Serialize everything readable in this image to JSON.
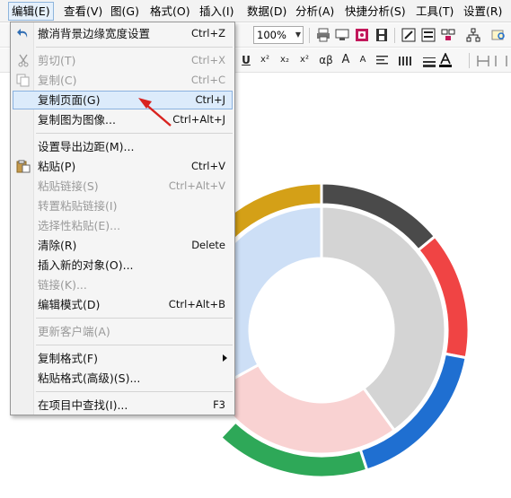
{
  "menubar": {
    "items": [
      {
        "label": "编辑(E)",
        "active": true
      },
      {
        "label": "查看(V)"
      },
      {
        "label": "图(G)"
      },
      {
        "label": "格式(O)"
      },
      {
        "label": "插入(I)"
      },
      {
        "label": "数据(D)"
      },
      {
        "label": "分析(A)"
      },
      {
        "label": "快捷分析(S)"
      },
      {
        "label": "工具(T)"
      },
      {
        "label": "设置(R)"
      }
    ]
  },
  "toolbar": {
    "zoom_value": "100%",
    "font_style_labels": [
      "U",
      "x²",
      "x₂",
      "x²",
      "αβ",
      "A",
      "A"
    ]
  },
  "edit_menu": {
    "items": [
      {
        "label": "撤消背景边缘宽度设置",
        "shortcut": "Ctrl+Z",
        "icon": "undo-icon"
      },
      {
        "label": "剪切(T)",
        "shortcut": "Ctrl+X",
        "disabled": true,
        "icon": "cut-icon"
      },
      {
        "label": "复制(C)",
        "shortcut": "Ctrl+C",
        "disabled": true,
        "icon": "copy-icon"
      },
      {
        "label": "复制页面(G)",
        "shortcut": "Ctrl+J",
        "highlighted": true
      },
      {
        "label": "复制图为图像...",
        "shortcut": "Ctrl+Alt+J"
      },
      {
        "label": "设置导出边距(M)...",
        "shortcut": ""
      },
      {
        "label": "粘贴(P)",
        "shortcut": "Ctrl+V",
        "icon": "paste-icon"
      },
      {
        "label": "粘贴链接(S)",
        "shortcut": "Ctrl+Alt+V",
        "disabled": true
      },
      {
        "label": "转置粘贴链接(I)",
        "shortcut": "",
        "disabled": true
      },
      {
        "label": "选择性粘贴(E)...",
        "shortcut": "",
        "disabled": true
      },
      {
        "label": "清除(R)",
        "shortcut": "Delete"
      },
      {
        "label": "插入新的对象(O)...",
        "shortcut": ""
      },
      {
        "label": "链接(K)...",
        "shortcut": "",
        "disabled": true
      },
      {
        "label": "编辑模式(D)",
        "shortcut": "Ctrl+Alt+B"
      },
      {
        "label": "更新客户端(A)",
        "shortcut": "",
        "disabled": true
      },
      {
        "label": "复制格式(F)",
        "shortcut": "",
        "submenu": true
      },
      {
        "label": "粘贴格式(高级)(S)...",
        "shortcut": ""
      },
      {
        "label": "在项目中查找(I)...",
        "shortcut": "F3"
      }
    ]
  },
  "chart_data": {
    "type": "pie",
    "subtype": "nested-donut",
    "title": "",
    "rings": [
      {
        "ring": "outer",
        "slices": [
          {
            "value": 0.14,
            "color": "#4a4a4a"
          },
          {
            "value": 0.14,
            "color": "#f04444"
          },
          {
            "value": 0.17,
            "color": "#1f6fd1"
          },
          {
            "value": 0.17,
            "color": "#2ea858"
          },
          {
            "value": 0.25,
            "color": "#ffffff"
          },
          {
            "value": 0.13,
            "color": "#d4a017"
          }
        ]
      },
      {
        "ring": "inner",
        "slices": [
          {
            "value": 0.4,
            "color": "#d4d4d4"
          },
          {
            "value": 0.27,
            "color": "#f9d2d2"
          },
          {
            "value": 0.33,
            "color": "#cddff6"
          }
        ]
      }
    ]
  }
}
